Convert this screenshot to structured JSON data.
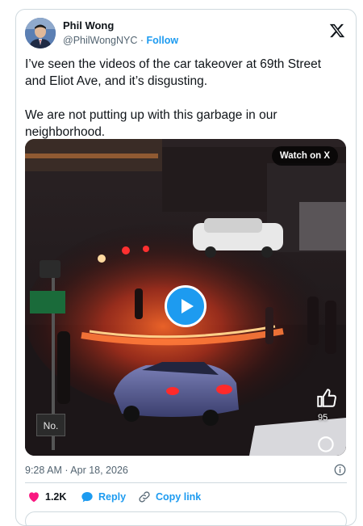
{
  "author": {
    "name": "Phil Wong",
    "handle": "@PhilWongNYC",
    "separator": "·",
    "follow_label": "Follow"
  },
  "tweet": {
    "paragraphs": [
      "I’ve seen the videos of the car takeover at 69th Street and Eliot Ave, and it’s disgusting.",
      "We are not putting up with this garbage in our neighborhood."
    ]
  },
  "media": {
    "watch_label": "Watch on X",
    "overlay_like_count": "95",
    "street_sign_text": "No."
  },
  "meta": {
    "timestamp": "9:28 AM · Apr 18, 2026"
  },
  "actions": {
    "like_count": "1.2K",
    "reply_label": "Reply",
    "copy_label": "Copy link"
  },
  "colors": {
    "accent": "#1d9bf0",
    "like_red": "#f91880",
    "text_primary": "#0f1419",
    "text_secondary": "#536471",
    "border": "#cfd9de"
  },
  "icons": {
    "close": "x-logo-icon",
    "play": "play-icon",
    "info": "info-icon",
    "like": "heart-icon",
    "reply": "speech-bubble-icon",
    "copy": "link-icon"
  }
}
